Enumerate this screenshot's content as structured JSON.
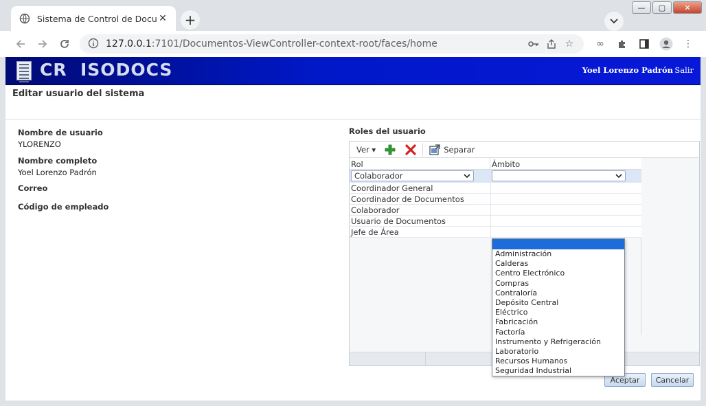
{
  "browser": {
    "tab_title": "Sistema de Control de Document",
    "url_host": "127.0.0.1",
    "url_rest": ":7101/Documentos-ViewController-context-root/faces/home",
    "window_controls": [
      "—",
      "▢",
      "✕"
    ]
  },
  "header": {
    "brand": "CR  ISODOCS",
    "user_name": "Yoel Lorenzo Padrón",
    "logout": "Salir"
  },
  "page": {
    "title": "Editar usuario del sistema"
  },
  "form": {
    "username_label": "Nombre de usuario",
    "username_value": "YLORENZO",
    "fullname_label": "Nombre completo",
    "fullname_value": "Yoel Lorenzo Padrón",
    "email_label": "Correo",
    "employee_code_label": "Código de empleado"
  },
  "roles": {
    "title": "Roles del usuario",
    "view_menu": "Ver",
    "detach_label": "Separar",
    "columns": [
      "Rol",
      "Ámbito"
    ],
    "edit_row": {
      "rol": "Colaborador",
      "ambito": ""
    },
    "rows": [
      "Coordinador General",
      "Coordinador de Documentos",
      "Colaborador",
      "Usuario de Documentos",
      "Jefe de Área"
    ],
    "ambito_options": [
      "Administración",
      "Calderas",
      "Centro Electrónico",
      "Compras",
      "Contraloría",
      "Depósito Central",
      "Eléctrico",
      "Fabricación",
      "Factoría",
      "Instrumento y Refrigeración",
      "Laboratorio",
      "Recursos Humanos",
      "Seguridad Industrial"
    ]
  },
  "actions": {
    "accept": "Aceptar",
    "cancel": "Cancelar"
  },
  "colors": {
    "banner": "#0018c8",
    "selection": "#1e6cd8",
    "add_icon": "#2e9d2e",
    "delete_icon": "#d42020"
  }
}
